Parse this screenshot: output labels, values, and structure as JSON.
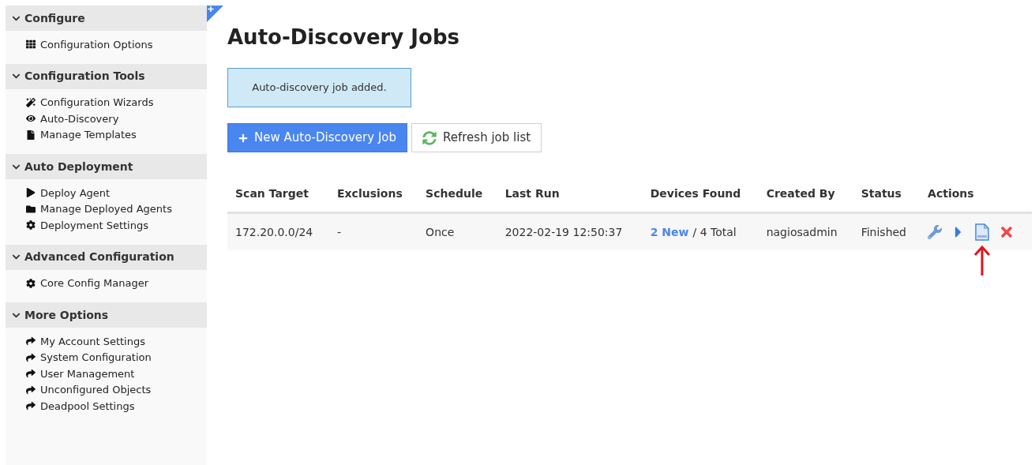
{
  "sidebar": {
    "sections": [
      {
        "title": "Configure",
        "expanded": true,
        "items": [
          {
            "label": "Configuration Options",
            "kind": "grid"
          }
        ]
      },
      {
        "title": "Configuration Tools",
        "expanded": true,
        "items": [
          {
            "label": "Configuration Wizards",
            "kind": "wand"
          },
          {
            "label": "Auto-Discovery",
            "kind": "eye"
          },
          {
            "label": "Manage Templates",
            "kind": "file"
          }
        ]
      },
      {
        "title": "Auto Deployment",
        "expanded": true,
        "items": [
          {
            "label": "Deploy Agent",
            "kind": "play"
          },
          {
            "label": "Manage Deployed Agents",
            "kind": "folder"
          },
          {
            "label": "Deployment Settings",
            "kind": "gear"
          }
        ]
      },
      {
        "title": "Advanced Configuration",
        "expanded": true,
        "items": [
          {
            "label": "Core Config Manager",
            "kind": "gear"
          }
        ]
      },
      {
        "title": "More Options",
        "expanded": true,
        "items": [
          {
            "label": "My Account Settings",
            "kind": "share"
          },
          {
            "label": "System Configuration",
            "kind": "share"
          },
          {
            "label": "User Management",
            "kind": "share"
          },
          {
            "label": "Unconfigured Objects",
            "kind": "share"
          },
          {
            "label": "Deadpool Settings",
            "kind": "share"
          }
        ]
      }
    ]
  },
  "page_title": "Auto-Discovery Jobs",
  "alert": "Auto-discovery job added.",
  "buttons": [
    {
      "label": "New Auto-Discovery Job",
      "kind": "primary"
    },
    {
      "label": "Refresh job list",
      "kind": "refresh"
    }
  ],
  "table": {
    "columns": [
      "Scan Target",
      "Exclusions",
      "Schedule",
      "Last Run",
      "Devices Found",
      "Created By",
      "Status",
      "Actions"
    ],
    "rows": [
      {
        "scan_target": "172.20.0.0/24",
        "exclusions": "-",
        "schedule": "Once",
        "last_run": "2022-02-19 12:50:37",
        "devices_new": "2 New",
        "devices_total": "/ 4 Total",
        "created_by": "nagiosadmin",
        "status": "Finished",
        "actions": [
          {
            "kind": "edit"
          },
          {
            "kind": "run"
          },
          {
            "kind": "log",
            "highlighted": true
          },
          {
            "kind": "delete"
          }
        ]
      }
    ]
  }
}
